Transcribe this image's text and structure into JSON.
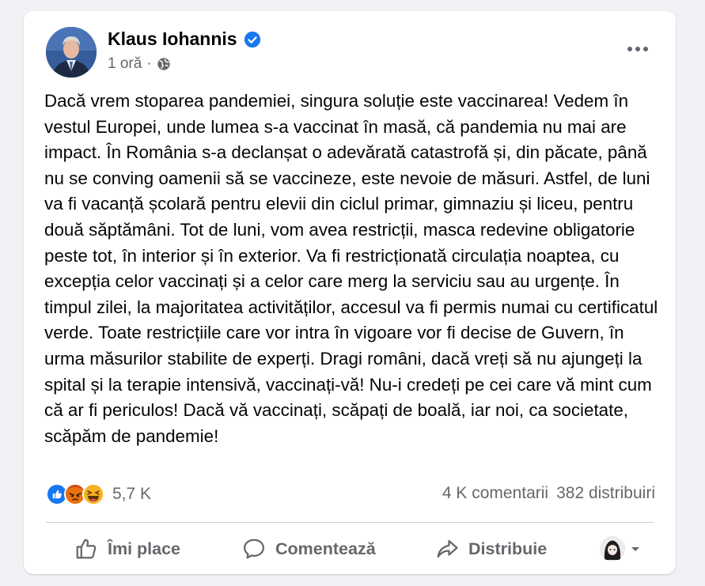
{
  "author": {
    "name": "Klaus Iohannis",
    "verified": true
  },
  "post_meta": {
    "time": "1 oră",
    "separator": "·",
    "audience_icon": "globe-icon"
  },
  "post": {
    "text": "Dacă vrem stoparea pandemiei, singura soluție este vaccinarea! Vedem în vestul Europei, unde lumea s-a vaccinat în masă, că pandemia nu mai are impact. În România s-a declanșat o adevărată catastrofă și, din păcate, până nu se conving oamenii să se vaccineze, este nevoie de măsuri. Astfel, de luni va fi vacanță școlară pentru elevii din ciclul primar, gimnaziu și liceu, pentru două săptămâni. Tot de luni, vom avea restricții, masca redevine obligatorie peste tot, în interior și în exterior. Va fi restricționată circulația noaptea, cu excepția celor vaccinați și a celor care merg la serviciu sau au urgențe. În timpul zilei, la majoritatea activităților, accesul va fi permis numai cu certificatul verde. Toate restricțiile care vor intra în vigoare vor fi decise de Guvern, în urma măsurilor stabilite de experți. Dragi români, dacă vreți să nu ajungeți la spital și la terapie intensivă, vaccinați-vă! Nu-i credeți pe cei care vă mint cum că ar fi periculos! Dacă vă vaccinați, scăpați de boală, iar noi, ca societate, scăpăm de pandemie!"
  },
  "stats": {
    "reactions": [
      "like",
      "angry",
      "haha"
    ],
    "reaction_count": "5,7 K",
    "comments": "4 K comentarii",
    "shares": "382 distribuiri"
  },
  "actions": {
    "like": "Îmi place",
    "comment": "Comentează",
    "share": "Distribuie"
  },
  "colors": {
    "like_blue": "#1877f2",
    "angry_orange": "#e9710f",
    "haha_yellow": "#f7b125",
    "text_secondary": "#65676b"
  }
}
